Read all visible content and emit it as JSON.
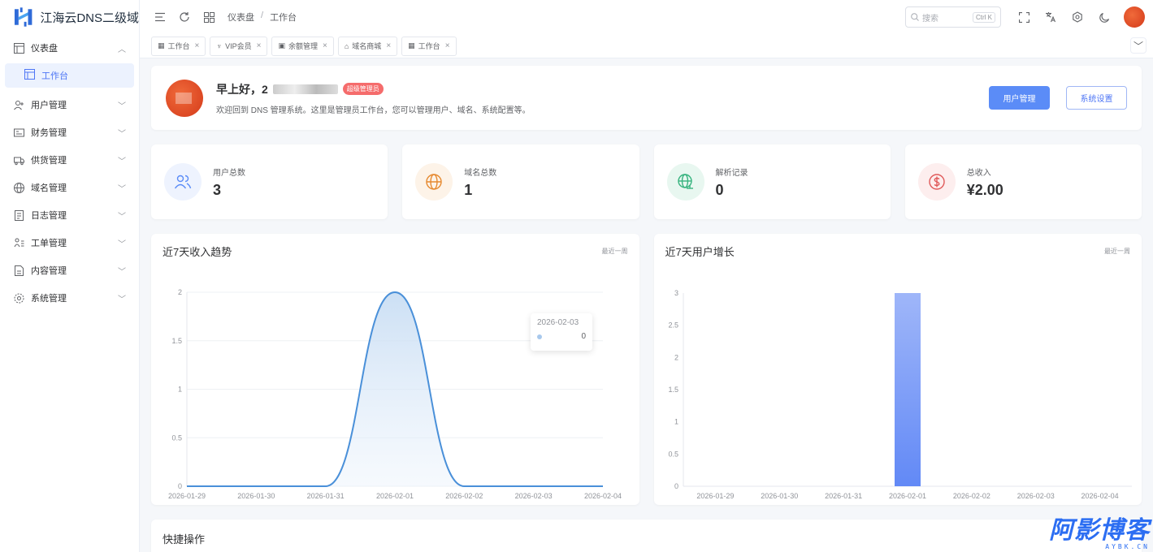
{
  "app": {
    "title": "江海云DNS二级域"
  },
  "sidebar": {
    "items": [
      {
        "label": "仪表盘",
        "icon": "dashboard-icon",
        "expanded": true
      },
      {
        "label": "用户管理",
        "icon": "user-add-icon"
      },
      {
        "label": "财务管理",
        "icon": "finance-icon"
      },
      {
        "label": "供货管理",
        "icon": "supply-truck-icon"
      },
      {
        "label": "域名管理",
        "icon": "globe-icon"
      },
      {
        "label": "日志管理",
        "icon": "log-icon"
      },
      {
        "label": "工单管理",
        "icon": "ticket-icon"
      },
      {
        "label": "内容管理",
        "icon": "content-icon"
      },
      {
        "label": "系统管理",
        "icon": "gear-icon"
      }
    ],
    "submenu": {
      "label": "工作台"
    }
  },
  "header": {
    "breadcrumb": [
      "仪表盘",
      "/",
      "工作台"
    ],
    "search_placeholder": "搜索",
    "search_kbd": "Ctrl K"
  },
  "tabs": [
    {
      "label": "工作台",
      "icon": "dashboard-icon"
    },
    {
      "label": "VIP会员",
      "icon": "vip-icon"
    },
    {
      "label": "余额管理",
      "icon": "wallet-icon"
    },
    {
      "label": "域名商城",
      "icon": "shop-icon"
    },
    {
      "label": "工作台",
      "icon": "dashboard-icon"
    }
  ],
  "welcome": {
    "greeting": "早上好，2",
    "role_badge": "超级管理员",
    "subtitle": "欢迎回到 DNS 管理系统。这里是管理员工作台，您可以管理用户、域名、系统配置等。",
    "btn_users": "用户管理",
    "btn_settings": "系统设置"
  },
  "stats": [
    {
      "label": "用户总数",
      "value": "3",
      "icon": "users-icon",
      "color": "#5b8cf7",
      "bg": "#eef3fe"
    },
    {
      "label": "域名总数",
      "value": "1",
      "icon": "globe-icon",
      "color": "#e6892f",
      "bg": "#fdf3e8"
    },
    {
      "label": "解析记录",
      "value": "0",
      "icon": "network-globe-icon",
      "color": "#36b37e",
      "bg": "#e8f7f0"
    },
    {
      "label": "总收入",
      "value": "¥2.00",
      "icon": "dollar-icon",
      "color": "#e05a5a",
      "bg": "#fdeeee"
    }
  ],
  "charts": {
    "income": {
      "title": "近7天收入趋势",
      "tag": "最近一周"
    },
    "users": {
      "title": "近7天用户增长",
      "tag": "最近一周"
    }
  },
  "tooltip": {
    "date": "2026-02-03",
    "value": "0"
  },
  "quick": {
    "title": "快捷操作"
  },
  "watermark": {
    "main": "阿影博客",
    "sub": "AYBK.CN"
  },
  "chart_data": [
    {
      "type": "area",
      "title": "近7天收入趋势",
      "categories": [
        "2026-01-29",
        "2026-01-30",
        "2026-01-31",
        "2026-02-01",
        "2026-02-02",
        "2026-02-03",
        "2026-02-04"
      ],
      "values": [
        0,
        0,
        0,
        2,
        0,
        0,
        0
      ],
      "yticks": [
        "0",
        "0.5",
        "1",
        "1.5",
        "2"
      ],
      "ylim": [
        0,
        2
      ],
      "color": "#4a90d9"
    },
    {
      "type": "bar",
      "title": "近7天用户增长",
      "categories": [
        "2026-01-29",
        "2026-01-30",
        "2026-01-31",
        "2026-02-01",
        "2026-02-02",
        "2026-02-03",
        "2026-02-04"
      ],
      "values": [
        0,
        0,
        0,
        3,
        0,
        0,
        0
      ],
      "yticks": [
        "0",
        "0.5",
        "1",
        "1.5",
        "2",
        "2.5",
        "3"
      ],
      "ylim": [
        0,
        3
      ],
      "color": "#6b93f7"
    }
  ]
}
